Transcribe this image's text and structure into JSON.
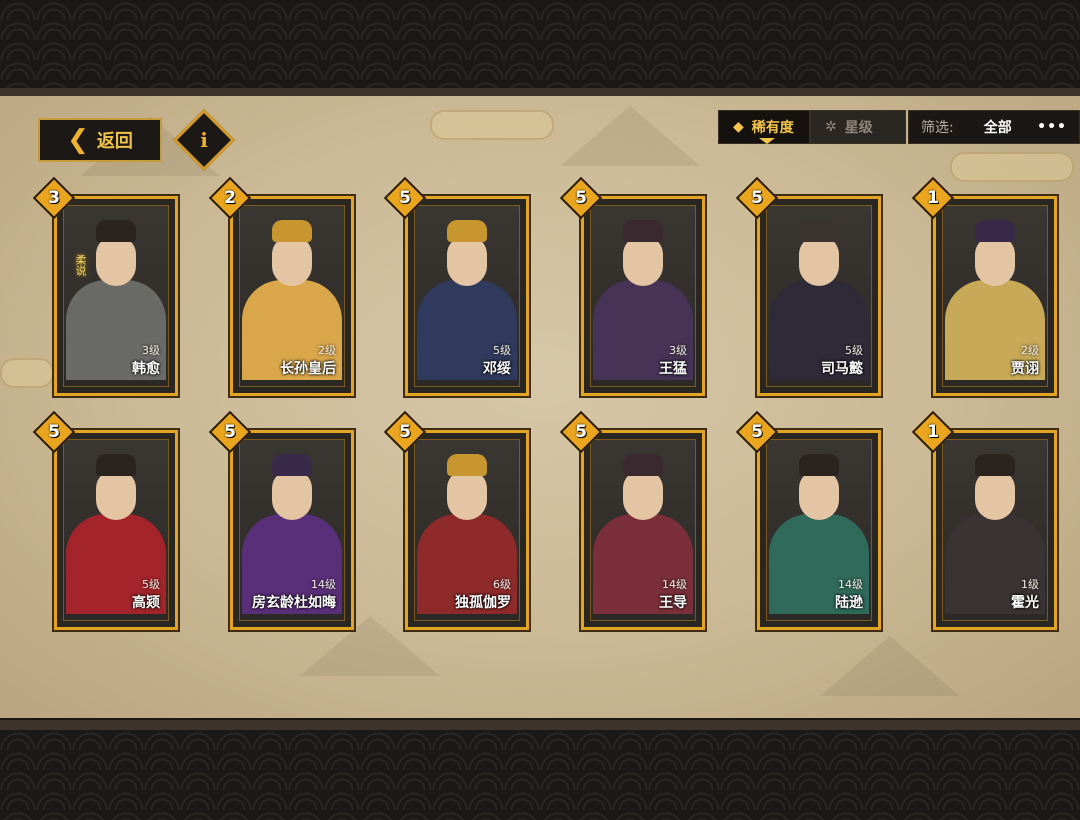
{
  "nav": {
    "back_label": "返回",
    "info_glyph": "i"
  },
  "tabs": {
    "rarity_label": "稀有度",
    "star_label": "星级",
    "star_icon_glyph": "✲",
    "rarity_icon_glyph": "◆"
  },
  "filter": {
    "label": "筛选:",
    "value": "全部",
    "more": "•••"
  },
  "cards": [
    {
      "rarity": "3",
      "level": "3级",
      "name": "韩愈",
      "tag": "柔说",
      "body_color": "#6a6a66",
      "hat_color": "#2b241e"
    },
    {
      "rarity": "2",
      "level": "2级",
      "name": "长孙皇后",
      "tag": "",
      "body_color": "#d9a64a",
      "hat_color": "#c8962f"
    },
    {
      "rarity": "5",
      "level": "5级",
      "name": "邓绥",
      "tag": "",
      "body_color": "#2f3a5c",
      "hat_color": "#c8962f"
    },
    {
      "rarity": "5",
      "level": "3级",
      "name": "王猛",
      "tag": "",
      "body_color": "#463356",
      "hat_color": "#3a2a2f"
    },
    {
      "rarity": "5",
      "level": "5级",
      "name": "司马懿",
      "tag": "",
      "body_color": "#2f2a38",
      "hat_color": "#3a3330"
    },
    {
      "rarity": "1",
      "level": "2级",
      "name": "贾诩",
      "tag": "",
      "body_color": "#c7a957",
      "hat_color": "#3a2a4a"
    },
    {
      "rarity": "5",
      "level": "5级",
      "name": "高颎",
      "tag": "",
      "body_color": "#a3242a",
      "hat_color": "#2b241e"
    },
    {
      "rarity": "5",
      "level": "14级",
      "name": "房玄龄杜如晦",
      "tag": "",
      "body_color": "#5a2f7a",
      "hat_color": "#3a2a4a"
    },
    {
      "rarity": "5",
      "level": "6级",
      "name": "独孤伽罗",
      "tag": "",
      "body_color": "#8e2a2a",
      "hat_color": "#c8962f"
    },
    {
      "rarity": "5",
      "level": "14级",
      "name": "王导",
      "tag": "",
      "body_color": "#7a2f3a",
      "hat_color": "#3a2a2f"
    },
    {
      "rarity": "5",
      "level": "14级",
      "name": "陆逊",
      "tag": "",
      "body_color": "#2f6a5a",
      "hat_color": "#2b241e"
    },
    {
      "rarity": "1",
      "level": "1级",
      "name": "霍光",
      "tag": "",
      "body_color": "#3a3333",
      "hat_color": "#2b241e"
    }
  ]
}
